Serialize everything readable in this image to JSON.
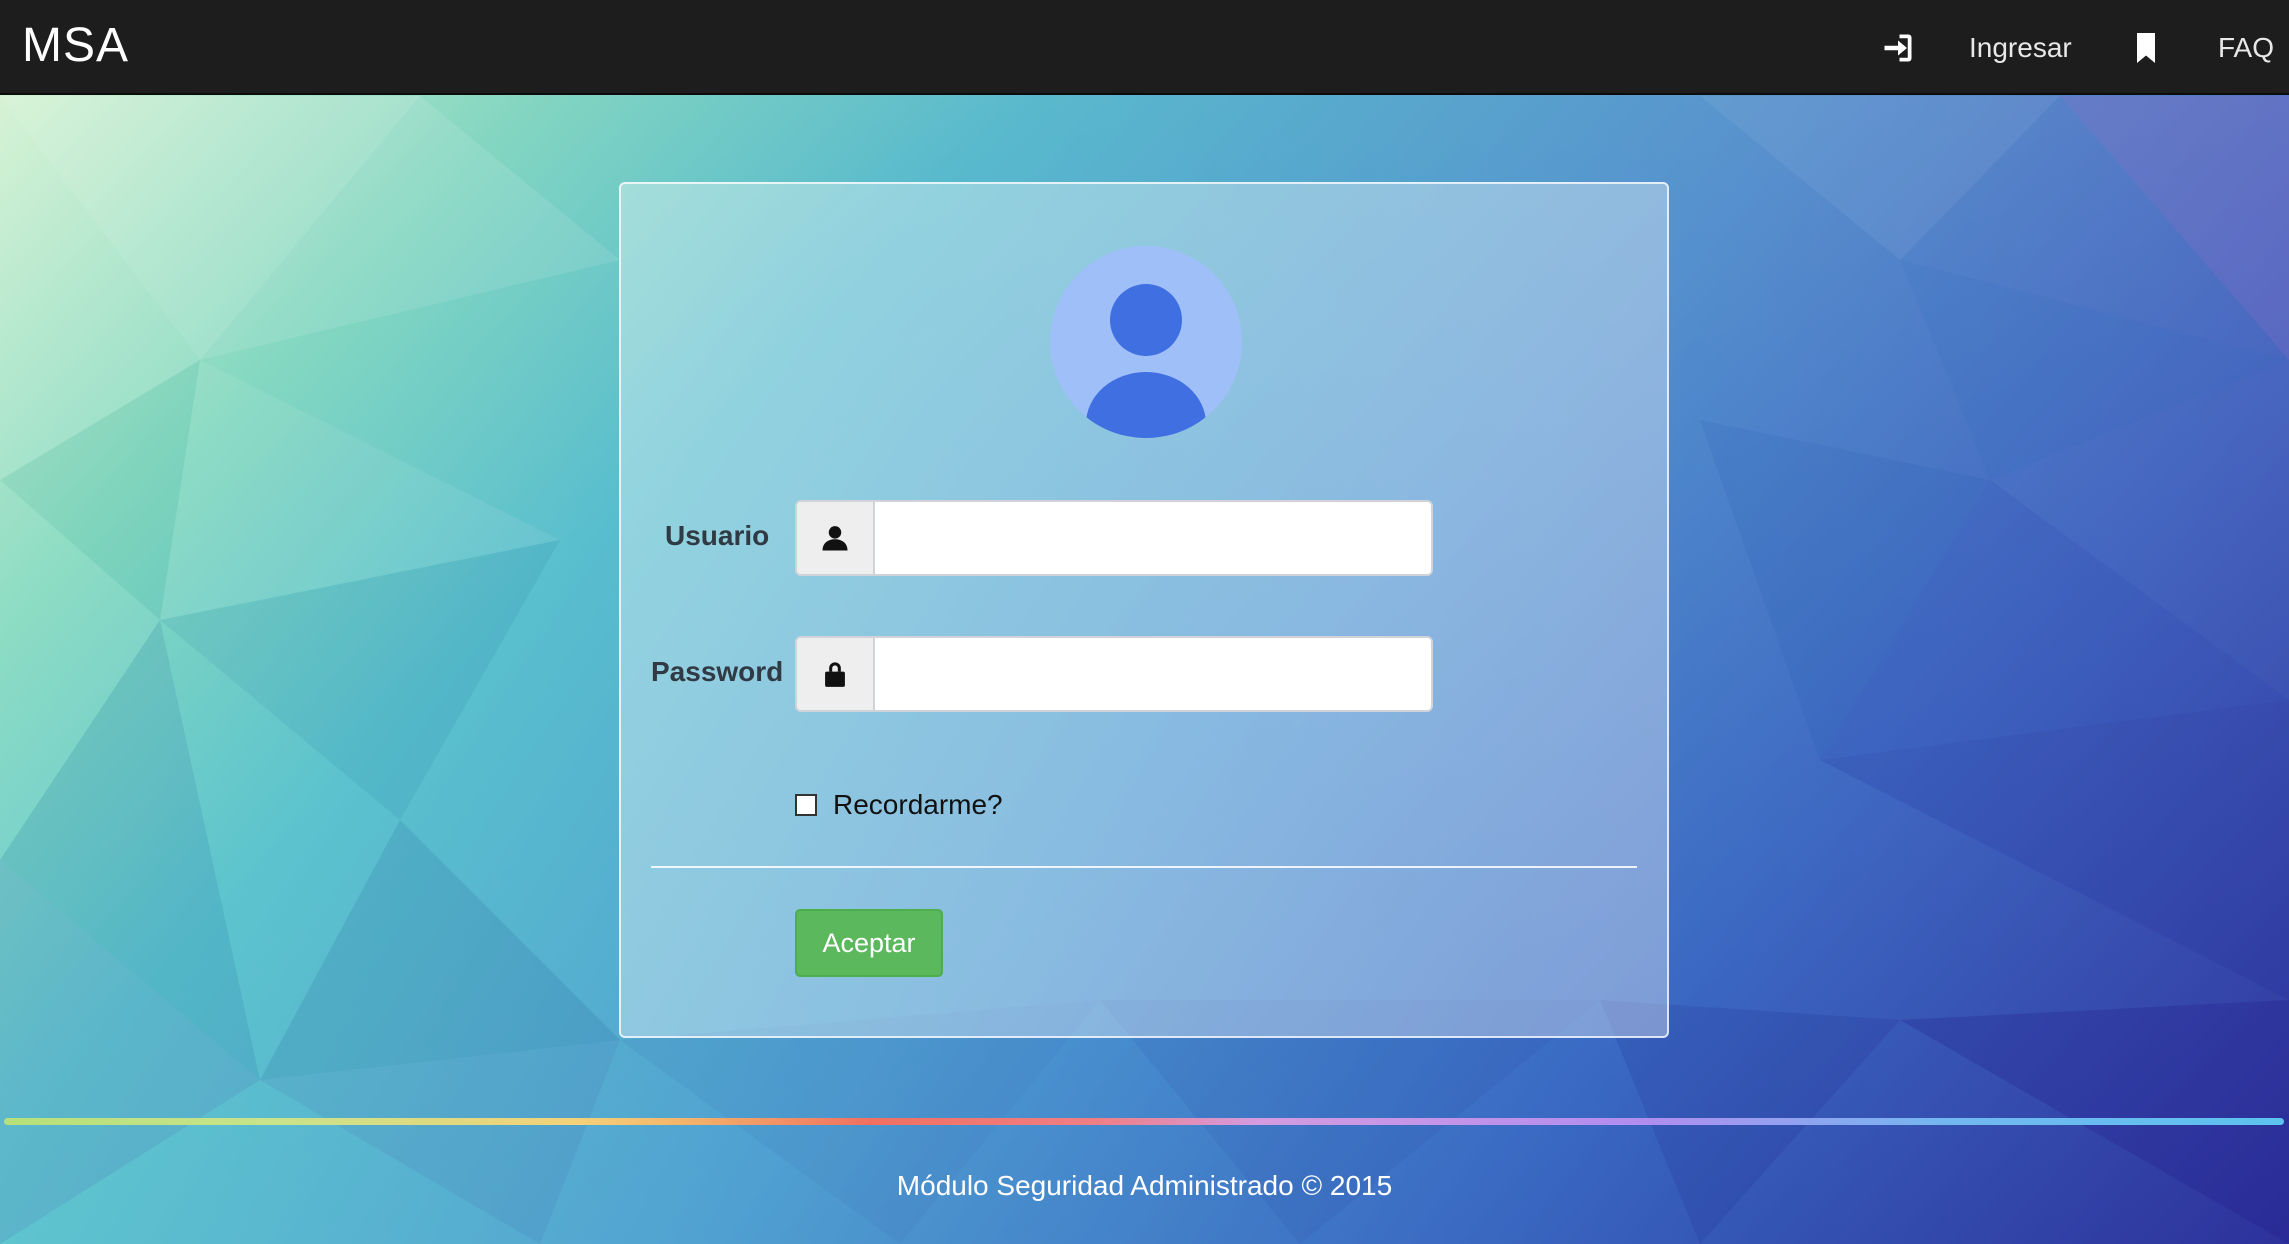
{
  "navbar": {
    "brand": "MSA",
    "login_icon": "sign-in-icon",
    "login_label": "Ingresar",
    "faq_icon": "bookmark-icon",
    "faq_label": "FAQ"
  },
  "login_form": {
    "avatar_icon": "user-avatar-icon",
    "username_label": "Usuario",
    "username_icon": "user-icon",
    "username_value": "",
    "password_label": "Password",
    "password_icon": "lock-icon",
    "password_value": "",
    "remember_label": "Recordarme?",
    "remember_checked": false,
    "submit_label": "Aceptar"
  },
  "footer": {
    "text": "Módulo Seguridad Administrado © 2015"
  },
  "colors": {
    "navbar_bg": "#1d1d1d",
    "submit_bg": "#5cb85c",
    "avatar_bg": "#9fbff8",
    "avatar_figure": "#3f6fe0"
  }
}
